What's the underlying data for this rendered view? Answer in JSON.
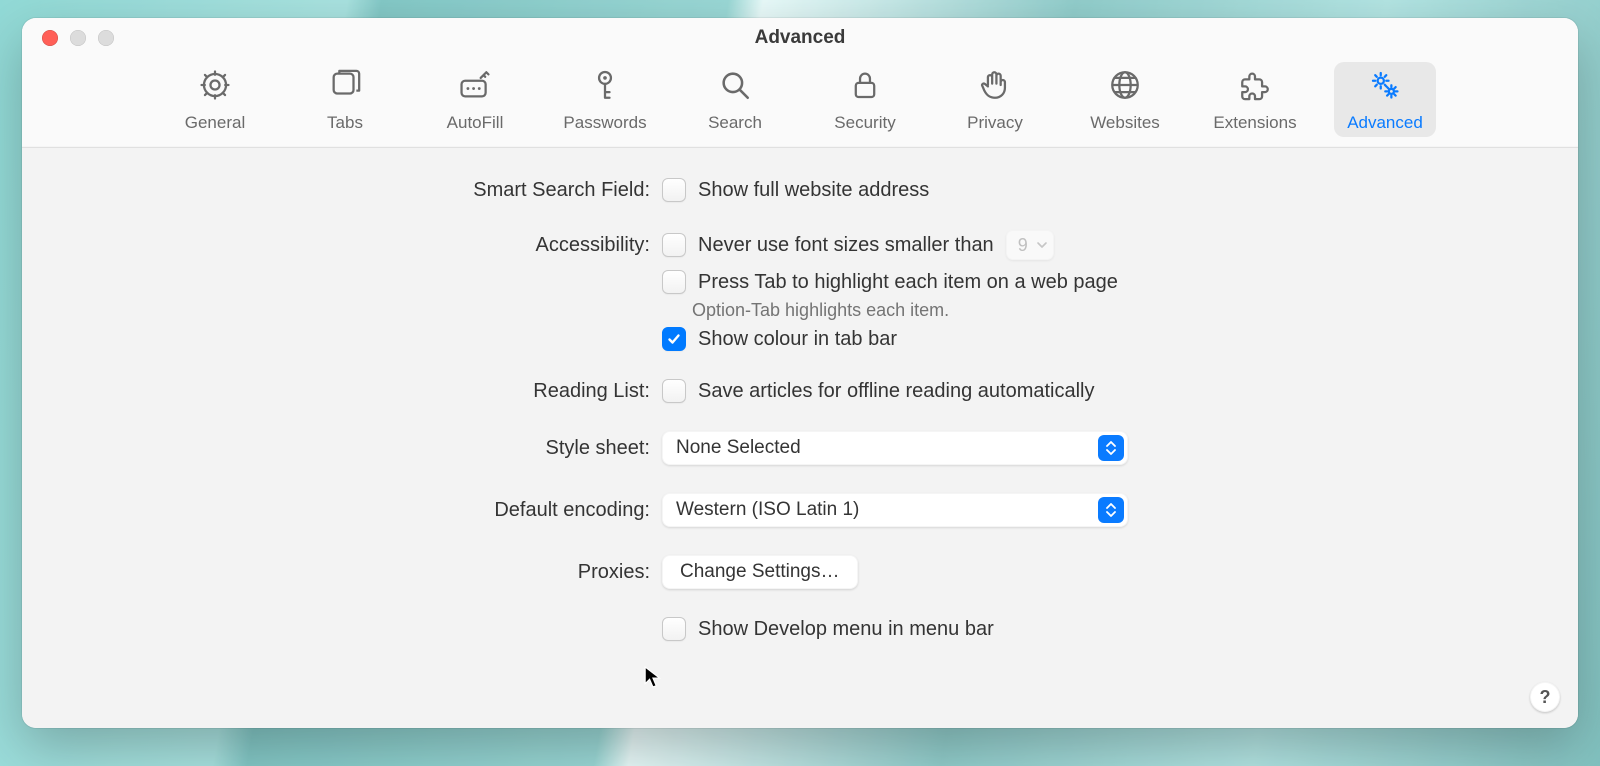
{
  "window": {
    "title": "Advanced"
  },
  "toolbar": {
    "items": [
      {
        "id": "general",
        "label": "General"
      },
      {
        "id": "tabs",
        "label": "Tabs"
      },
      {
        "id": "autofill",
        "label": "AutoFill"
      },
      {
        "id": "passwords",
        "label": "Passwords"
      },
      {
        "id": "search",
        "label": "Search"
      },
      {
        "id": "security",
        "label": "Security"
      },
      {
        "id": "privacy",
        "label": "Privacy"
      },
      {
        "id": "websites",
        "label": "Websites"
      },
      {
        "id": "extensions",
        "label": "Extensions"
      },
      {
        "id": "advanced",
        "label": "Advanced"
      }
    ],
    "active": "advanced"
  },
  "sections": {
    "smart_search": {
      "label": "Smart Search Field:",
      "show_full_address": {
        "label": "Show full website address",
        "checked": false
      }
    },
    "accessibility": {
      "label": "Accessibility:",
      "min_font": {
        "label": "Never use font sizes smaller than",
        "checked": false,
        "value": "9",
        "enabled": false
      },
      "tab_highlight": {
        "label": "Press Tab to highlight each item on a web page",
        "checked": false
      },
      "tab_highlight_hint": "Option-Tab highlights each item.",
      "show_colour_tab": {
        "label": "Show colour in tab bar",
        "checked": true
      }
    },
    "reading_list": {
      "label": "Reading List:",
      "save_offline": {
        "label": "Save articles for offline reading automatically",
        "checked": false
      }
    },
    "style_sheet": {
      "label": "Style sheet:",
      "value": "None Selected"
    },
    "default_encoding": {
      "label": "Default encoding:",
      "value": "Western (ISO Latin 1)"
    },
    "proxies": {
      "label": "Proxies:",
      "button": "Change Settings…"
    },
    "develop_menu": {
      "label": "Show Develop menu in menu bar",
      "checked": false
    }
  },
  "help_label": "?"
}
